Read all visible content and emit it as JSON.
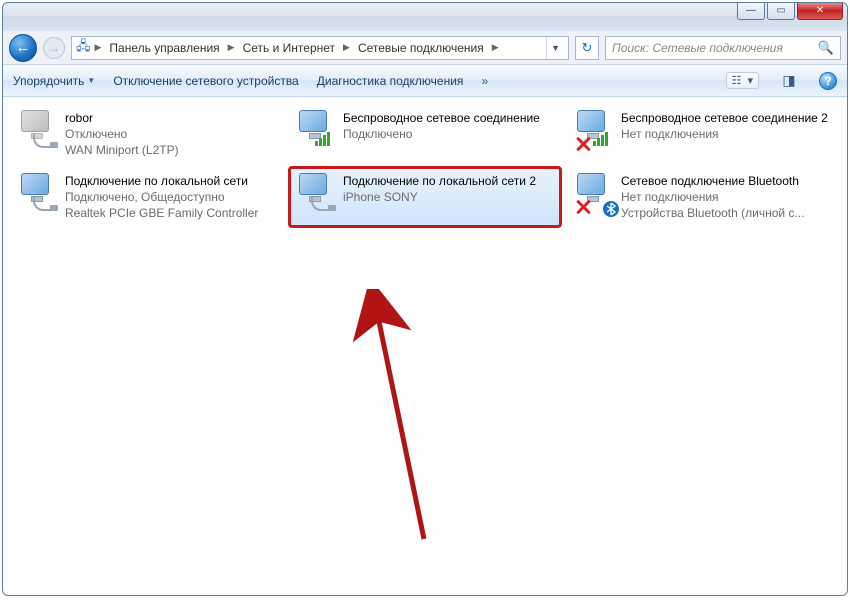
{
  "titlebar": {
    "minimize_glyph": "—",
    "maximize_glyph": "▭",
    "close_glyph": "✕"
  },
  "navbar": {
    "path_icon": "▧",
    "crumbs": [
      "Панель управления",
      "Сеть и Интернет",
      "Сетевые подключения"
    ],
    "search_placeholder": "Поиск: Сетевые подключения"
  },
  "cmdbar": {
    "organize": "Упорядочить",
    "disable": "Отключение сетевого устройства",
    "diagnose": "Диагностика подключения"
  },
  "connections": [
    {
      "title": "robor",
      "status": "Отключено",
      "device": "WAN Miniport (L2TP)",
      "icon": "dialup",
      "gray": true
    },
    {
      "title": "Беспроводное сетевое соединение",
      "status": "Подключено",
      "device": "",
      "icon": "wifi",
      "gray": false
    },
    {
      "title": "Беспроводное сетевое соединение 2",
      "status": "Нет подключения",
      "device": "",
      "icon": "wifi-x",
      "gray": false
    },
    {
      "title": "Подключение по локальной сети",
      "status": "Подключено, Общедоступно",
      "device": "Realtek PCIe GBE Family Controller",
      "icon": "lan",
      "gray": false
    },
    {
      "title": "Подключение по локальной сети 2",
      "status": "",
      "device": "iPhone SONY",
      "icon": "lan",
      "gray": false,
      "selected": true,
      "highlight": true
    },
    {
      "title": "Сетевое подключение Bluetooth",
      "status": "Нет подключения",
      "device": "Устройства Bluetooth (личной с...",
      "icon": "bt-x",
      "gray": false
    }
  ]
}
